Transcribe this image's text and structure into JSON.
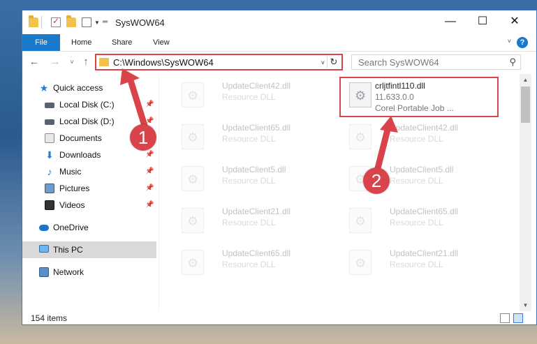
{
  "window": {
    "title": "SysWOW64",
    "controls": {
      "minimize": "—",
      "maximize": "☐",
      "close": "✕"
    }
  },
  "ribbon": {
    "file_tab": "File",
    "tabs": [
      "Home",
      "Share",
      "View"
    ],
    "help": "?"
  },
  "navigation": {
    "address": "C:\\Windows\\SysWOW64",
    "search_placeholder": "Search SysWOW64"
  },
  "sidebar": {
    "items": [
      {
        "label": "Quick access",
        "icon": "star-icon",
        "pinned": false
      },
      {
        "label": "Local Disk (C:)",
        "icon": "disk-icon",
        "pinned": true
      },
      {
        "label": "Local Disk (D:)",
        "icon": "disk-icon",
        "pinned": true
      },
      {
        "label": "Documents",
        "icon": "documents-icon",
        "pinned": true
      },
      {
        "label": "Downloads",
        "icon": "download-icon",
        "pinned": true
      },
      {
        "label": "Music",
        "icon": "music-icon",
        "pinned": true
      },
      {
        "label": "Pictures",
        "icon": "pictures-icon",
        "pinned": true
      },
      {
        "label": "Videos",
        "icon": "videos-icon",
        "pinned": true
      },
      {
        "label": "OneDrive",
        "icon": "cloud-icon",
        "pinned": false
      },
      {
        "label": "This PC",
        "icon": "computer-icon",
        "pinned": false,
        "selected": true
      },
      {
        "label": "Network",
        "icon": "network-icon",
        "pinned": false
      }
    ]
  },
  "files": {
    "left_column": [
      {
        "name": "UpdateClient42.dll",
        "type": "Resource DLL"
      },
      {
        "name": "UpdateClient65.dll",
        "type": "Resource DLL"
      },
      {
        "name": "UpdateClient5.dll",
        "type": "Resource DLL"
      },
      {
        "name": "UpdateClient21.dll",
        "type": "Resource DLL"
      },
      {
        "name": "UpdateClient65.dll",
        "type": "Resource DLL"
      }
    ],
    "right_column": [
      {
        "name": "crljtfintl110.dll",
        "version": "11.633.0.0",
        "type": "Corel Portable Job ..."
      },
      {
        "name": "UpdateClient42.dll",
        "type": "Resource DLL"
      },
      {
        "name": "UpdateClient5.dll",
        "type": "Resource DLL"
      },
      {
        "name": "UpdateClient65.dll",
        "type": "Resource DLL"
      },
      {
        "name": "UpdateClient21.dll",
        "type": "Resource DLL"
      }
    ]
  },
  "status": {
    "item_count": "154 items"
  },
  "annotations": {
    "step1": "1",
    "step2": "2",
    "color": "#d9434a"
  }
}
